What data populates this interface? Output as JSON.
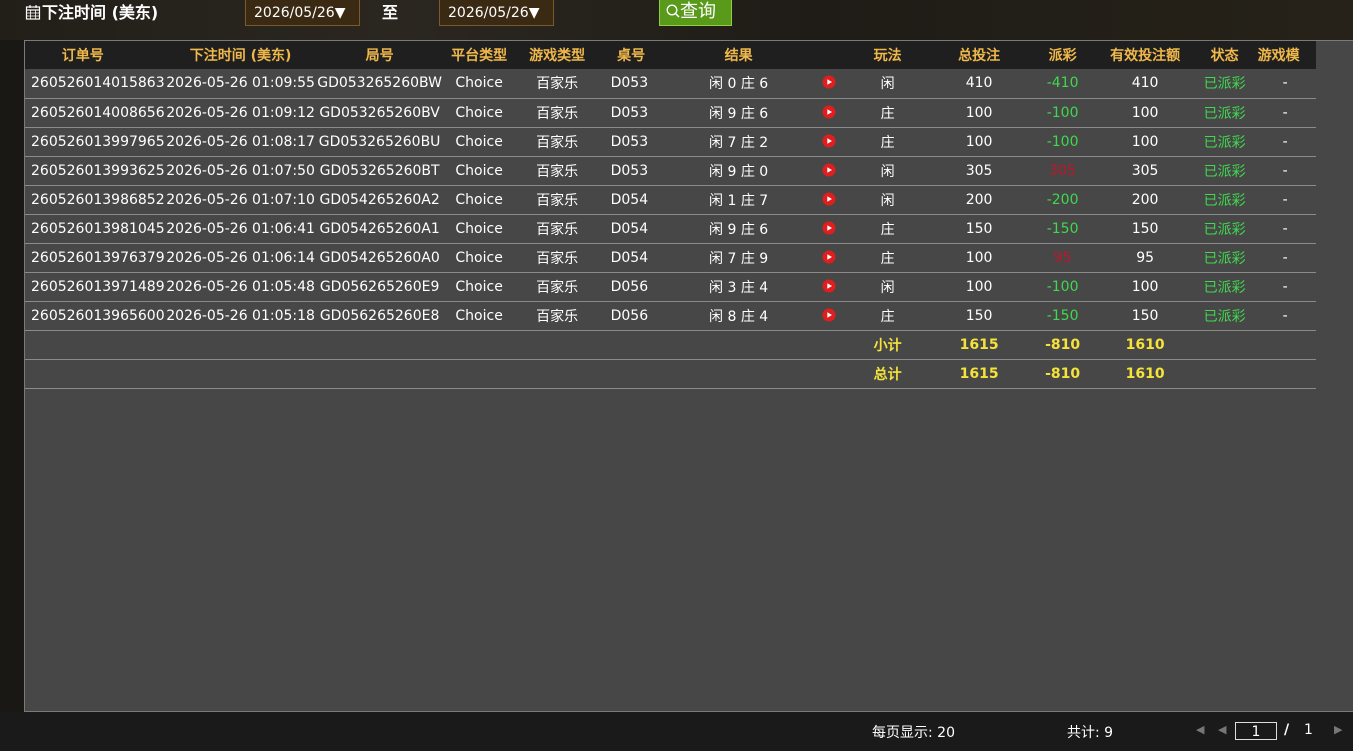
{
  "filter": {
    "title": "下注时间 (美东)",
    "date_from": "2026/05/26▼",
    "to_label": "至",
    "date_to": "2026/05/26▼",
    "query_label": "查询"
  },
  "table": {
    "headers": [
      "订单号",
      "下注时间 (美东)",
      "局号",
      "平台类型",
      "游戏类型",
      "桌号",
      "结果",
      "",
      "玩法",
      "总投注",
      "派彩",
      "有效投注额",
      "状态",
      "游戏模"
    ],
    "rows": [
      {
        "order": "260526014015863",
        "time": "2026-05-26 01:09:55",
        "round": "GD053265260BW",
        "platform": "Choice",
        "game": "百家乐",
        "table": "D053",
        "result": "闲 0 庄 6",
        "play": "闲",
        "bet": "410",
        "payout": "-410",
        "payout_color": "green",
        "valid": "410",
        "status": "已派彩",
        "mode": "-"
      },
      {
        "order": "260526014008656",
        "time": "2026-05-26 01:09:12",
        "round": "GD053265260BV",
        "platform": "Choice",
        "game": "百家乐",
        "table": "D053",
        "result": "闲 9 庄 6",
        "play": "庄",
        "bet": "100",
        "payout": "-100",
        "payout_color": "green",
        "valid": "100",
        "status": "已派彩",
        "mode": "-"
      },
      {
        "order": "260526013997965",
        "time": "2026-05-26 01:08:17",
        "round": "GD053265260BU",
        "platform": "Choice",
        "game": "百家乐",
        "table": "D053",
        "result": "闲 7 庄 2",
        "play": "庄",
        "bet": "100",
        "payout": "-100",
        "payout_color": "green",
        "valid": "100",
        "status": "已派彩",
        "mode": "-"
      },
      {
        "order": "260526013993625",
        "time": "2026-05-26 01:07:50",
        "round": "GD053265260BT",
        "platform": "Choice",
        "game": "百家乐",
        "table": "D053",
        "result": "闲 9 庄 0",
        "play": "闲",
        "bet": "305",
        "payout": "305",
        "payout_color": "red",
        "valid": "305",
        "status": "已派彩",
        "mode": "-"
      },
      {
        "order": "260526013986852",
        "time": "2026-05-26 01:07:10",
        "round": "GD054265260A2",
        "platform": "Choice",
        "game": "百家乐",
        "table": "D054",
        "result": "闲 1 庄 7",
        "play": "闲",
        "bet": "200",
        "payout": "-200",
        "payout_color": "green",
        "valid": "200",
        "status": "已派彩",
        "mode": "-"
      },
      {
        "order": "260526013981045",
        "time": "2026-05-26 01:06:41",
        "round": "GD054265260A1",
        "platform": "Choice",
        "game": "百家乐",
        "table": "D054",
        "result": "闲 9 庄 6",
        "play": "庄",
        "bet": "150",
        "payout": "-150",
        "payout_color": "green",
        "valid": "150",
        "status": "已派彩",
        "mode": "-"
      },
      {
        "order": "260526013976379",
        "time": "2026-05-26 01:06:14",
        "round": "GD054265260A0",
        "platform": "Choice",
        "game": "百家乐",
        "table": "D054",
        "result": "闲 7 庄 9",
        "play": "庄",
        "bet": "100",
        "payout": "95",
        "payout_color": "red",
        "valid": "95",
        "status": "已派彩",
        "mode": "-"
      },
      {
        "order": "260526013971489",
        "time": "2026-05-26 01:05:48",
        "round": "GD056265260E9",
        "platform": "Choice",
        "game": "百家乐",
        "table": "D056",
        "result": "闲 3 庄 4",
        "play": "闲",
        "bet": "100",
        "payout": "-100",
        "payout_color": "green",
        "valid": "100",
        "status": "已派彩",
        "mode": "-"
      },
      {
        "order": "260526013965600",
        "time": "2026-05-26 01:05:18",
        "round": "GD056265260E8",
        "platform": "Choice",
        "game": "百家乐",
        "table": "D056",
        "result": "闲 8 庄 4",
        "play": "庄",
        "bet": "150",
        "payout": "-150",
        "payout_color": "green",
        "valid": "150",
        "status": "已派彩",
        "mode": "-"
      }
    ],
    "subtotal": {
      "label": "小计",
      "bet": "1615",
      "payout": "-810",
      "valid": "1610"
    },
    "total": {
      "label": "总计",
      "bet": "1615",
      "payout": "-810",
      "valid": "1610"
    }
  },
  "footer": {
    "per_page": "每页显示: 20",
    "total": "共计: 9",
    "page_current": "1",
    "page_sep": "/",
    "page_total": "1"
  },
  "colors": {
    "header_text": "#f0b84a",
    "positive_payout": "#3fd84f",
    "negative_payout": "#c0152a",
    "sum_text": "#f5e33a",
    "query_button": "#5a9a1a"
  },
  "icons": [
    "calendar-icon",
    "search-icon",
    "play-video-icon",
    "first-page-icon",
    "prev-page-icon",
    "next-page-icon"
  ]
}
